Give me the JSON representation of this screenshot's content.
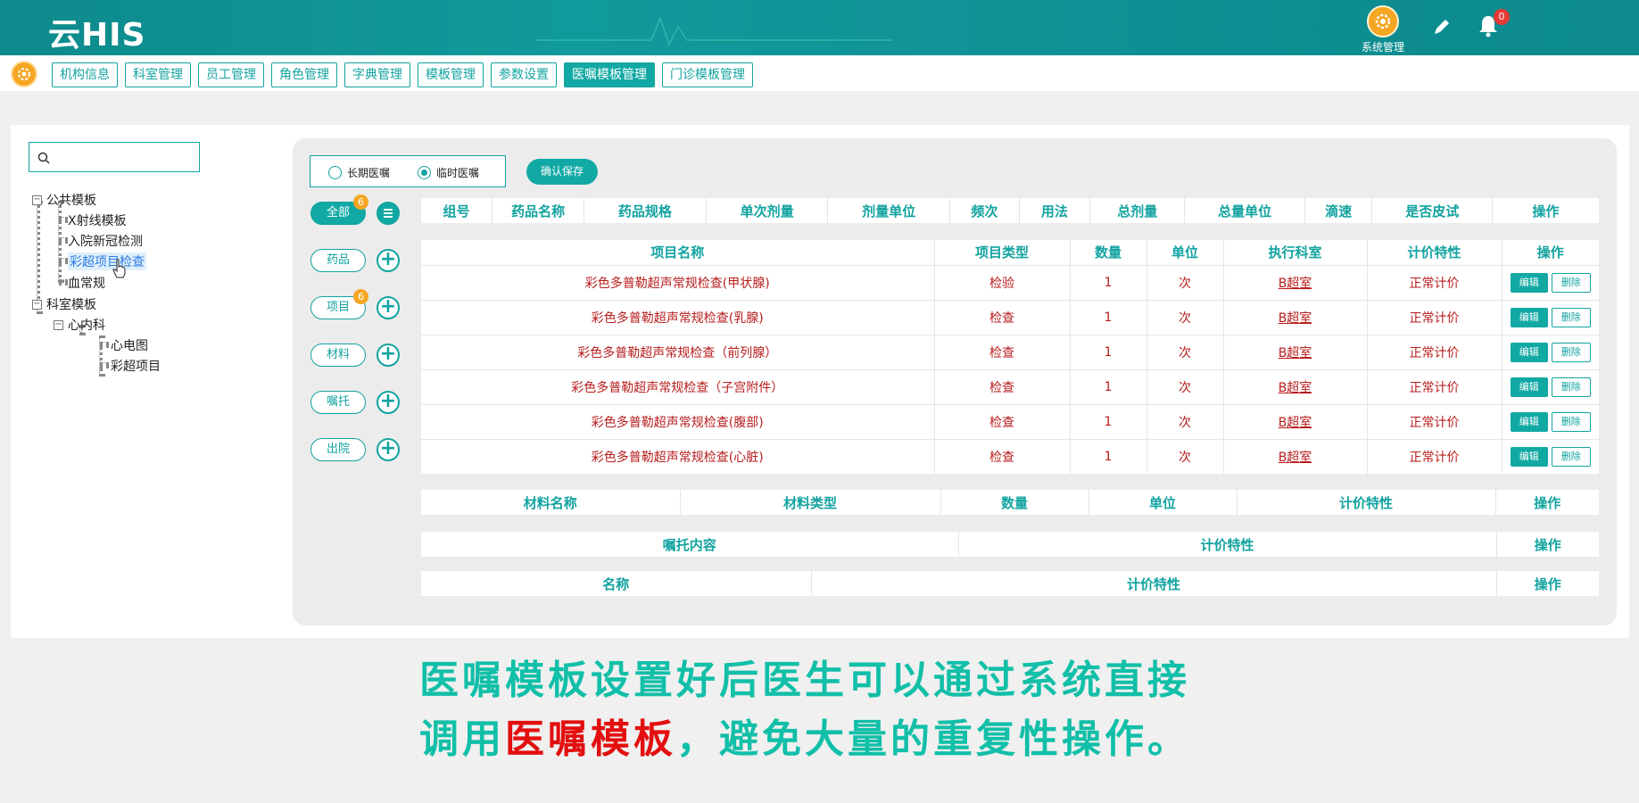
{
  "header": {
    "logo": "云HIS",
    "system_label": "系统管理",
    "notification_count": "0"
  },
  "nav": {
    "tabs": [
      "机构信息",
      "科室管理",
      "员工管理",
      "角色管理",
      "字典管理",
      "模板管理",
      "参数设置",
      "医嘱模板管理",
      "门诊模板管理"
    ],
    "active_index": 7
  },
  "tree": {
    "public_root": "公共模板",
    "public_items": [
      "X射线模板",
      "入院新冠检测",
      "彩超项目检查",
      "血常规"
    ],
    "dept_root": "科室模板",
    "dept_child": "心内科",
    "dept_items": [
      "心电图",
      "彩超项目"
    ]
  },
  "order_type": {
    "long_term": "长期医嘱",
    "temporary": "临时医嘱",
    "selected": "临时医嘱",
    "confirm": "确认保存"
  },
  "categories": [
    {
      "label": "全部",
      "badge": "6"
    },
    {
      "label": "药品",
      "badge": ""
    },
    {
      "label": "项目",
      "badge": "6"
    },
    {
      "label": "材料",
      "badge": ""
    },
    {
      "label": "嘱托",
      "badge": ""
    },
    {
      "label": "出院",
      "badge": ""
    }
  ],
  "drug_table": {
    "headers": [
      "组号",
      "药品名称",
      "药品规格",
      "单次剂量",
      "剂量单位",
      "频次",
      "用法",
      "总剂量",
      "总量单位",
      "滴速",
      "是否皮试",
      "操作"
    ]
  },
  "item_table": {
    "headers": [
      "项目名称",
      "项目类型",
      "数量",
      "单位",
      "执行科室",
      "计价特性",
      "操作"
    ],
    "edit_label": "编辑",
    "delete_label": "删除",
    "rows": [
      [
        "彩色多普勒超声常规检查(甲状腺)",
        "检验",
        "1",
        "次",
        "B超室",
        "正常计价"
      ],
      [
        "彩色多普勒超声常规检查(乳腺)",
        "检查",
        "1",
        "次",
        "B超室",
        "正常计价"
      ],
      [
        "彩色多普勒超声常规检查（前列腺）",
        "检查",
        "1",
        "次",
        "B超室",
        "正常计价"
      ],
      [
        "彩色多普勒超声常规检查（子宫附件）",
        "检查",
        "1",
        "次",
        "B超室",
        "正常计价"
      ],
      [
        "彩色多普勒超声常规检查(腹部)",
        "检查",
        "1",
        "次",
        "B超室",
        "正常计价"
      ],
      [
        "彩色多普勒超声常规检查(心脏)",
        "检查",
        "1",
        "次",
        "B超室",
        "正常计价"
      ]
    ]
  },
  "material_table": {
    "headers": [
      "材料名称",
      "材料类型",
      "数量",
      "单位",
      "计价特性",
      "操作"
    ]
  },
  "entrust_table": {
    "headers": [
      "嘱托内容",
      "计价特性",
      "操作"
    ]
  },
  "discharge_table": {
    "headers": [
      "名称",
      "计价特性",
      "操作"
    ]
  },
  "caption": {
    "line1": "医嘱模板设置好后医生可以通过系统直接",
    "line2_prefix": "调用",
    "line2_highlight": "医嘱模板",
    "line2_suffix": "，避免大量的重复性操作。"
  },
  "colors": {
    "accent": "#12a9a4",
    "header": "#0f8f93",
    "badge": "#f5a623",
    "highlight": "#e30f0f",
    "caption": "#12bfa8"
  }
}
